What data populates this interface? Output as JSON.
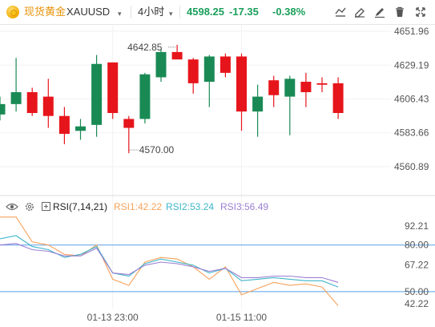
{
  "header": {
    "symbol_name": "现货黄金",
    "symbol_code": "XAUUSD",
    "symbol_chevron": "▾",
    "interval": "4小时",
    "interval_chevron": "▾",
    "last_price": "4598.25",
    "change_abs": "-17.35",
    "change_pct": "-0.38%",
    "icons": [
      "gold-coin-icon",
      "line-chart-icon",
      "eraser-icon",
      "pencil-icon",
      "trash-icon",
      "fullscreen-icon"
    ]
  },
  "rsi_legend": {
    "eye_icon": "eye-icon",
    "gear_icon": "gear-icon",
    "expand_icon": "plus-square-icon",
    "title": "RSI(7,14,21)",
    "rsi1": "RSI1:42.22",
    "rsi2": "RSI2:53.24",
    "rsi3": "RSI3:56.49"
  },
  "colors": {
    "up": "#1a8a55",
    "down": "#e6151b",
    "rsi1": "#f7a35c",
    "rsi2": "#3fb6c9",
    "rsi3": "#9b7fd4",
    "level_line": "#5aa0e6",
    "price_accent": "#1a9f5b",
    "symbol_accent": "#e8930a"
  },
  "chart_data": [
    {
      "type": "candlestick",
      "price_ticks": [
        "4651.96",
        "4629.19",
        "4606.43",
        "4583.66",
        "4560.89"
      ],
      "ylim": [
        4557,
        4655
      ],
      "annotations": {
        "high_label": "4642.85",
        "low_label": "4570.00"
      },
      "candles": [
        {
          "o": 4596.0,
          "h": 4608.0,
          "l": 4592.0,
          "c": 4603.0
        },
        {
          "o": 4603.0,
          "h": 4634.0,
          "l": 4598.0,
          "c": 4611.0
        },
        {
          "o": 4611.0,
          "h": 4614.0,
          "l": 4595.0,
          "c": 4597.0
        },
        {
          "o": 4608.0,
          "h": 4620.0,
          "l": 4587.0,
          "c": 4595.0
        },
        {
          "o": 4595.0,
          "h": 4601.0,
          "l": 4576.0,
          "c": 4583.0
        },
        {
          "o": 4585.0,
          "h": 4593.0,
          "l": 4579.0,
          "c": 4588.0
        },
        {
          "o": 4589.0,
          "h": 4636.0,
          "l": 4581.0,
          "c": 4630.0
        },
        {
          "o": 4631.0,
          "h": 4631.0,
          "l": 4593.0,
          "c": 4597.0
        },
        {
          "o": 4593.0,
          "h": 4595.0,
          "l": 4570.0,
          "c": 4587.0
        },
        {
          "o": 4593.0,
          "h": 4624.0,
          "l": 4590.0,
          "c": 4623.0
        },
        {
          "o": 4621.0,
          "h": 4640.0,
          "l": 4618.0,
          "c": 4638.0
        },
        {
          "o": 4638.0,
          "h": 4642.85,
          "l": 4636.0,
          "c": 4633.0
        },
        {
          "o": 4633.0,
          "h": 4634.0,
          "l": 4610.0,
          "c": 4617.0
        },
        {
          "o": 4618.0,
          "h": 4636.0,
          "l": 4601.0,
          "c": 4635.0
        },
        {
          "o": 4635.0,
          "h": 4637.0,
          "l": 4621.0,
          "c": 4624.0
        },
        {
          "o": 4635.0,
          "h": 4637.0,
          "l": 4585.0,
          "c": 4598.0
        },
        {
          "o": 4598.0,
          "h": 4616.0,
          "l": 4581.0,
          "c": 4608.0
        },
        {
          "o": 4619.0,
          "h": 4622.0,
          "l": 4601.0,
          "c": 4609.0
        },
        {
          "o": 4608.0,
          "h": 4622.0,
          "l": 4582.0,
          "c": 4620.0
        },
        {
          "o": 4618.0,
          "h": 4624.0,
          "l": 4601.0,
          "c": 4611.0
        },
        {
          "o": 4617.0,
          "h": 4621.0,
          "l": 4611.0,
          "c": 4616.0
        },
        {
          "o": 4617.0,
          "h": 4621.0,
          "l": 4593.0,
          "c": 4597.0
        }
      ]
    },
    {
      "type": "line",
      "title": "RSI(7,14,21)",
      "value_ticks": [
        "92.21",
        "80.00",
        "67.22",
        "50.00",
        "42.22"
      ],
      "ylim": [
        38,
        101
      ],
      "levels": [
        80,
        50
      ],
      "series": [
        {
          "name": "RSI1",
          "values": [
            98,
            98,
            82,
            80,
            74,
            73,
            80,
            58,
            54,
            69,
            72,
            71,
            66,
            58,
            66,
            48,
            52,
            56,
            54,
            55,
            53,
            41
          ]
        },
        {
          "name": "RSI2",
          "values": [
            84,
            86,
            79,
            77,
            72,
            74,
            79,
            62,
            60,
            68,
            71,
            69,
            67,
            62,
            65,
            57,
            58,
            59,
            58,
            57,
            57,
            53
          ]
        },
        {
          "name": "RSI3",
          "values": [
            80,
            81,
            77,
            76,
            73,
            73,
            78,
            62,
            61,
            67,
            69,
            68,
            66,
            63,
            65,
            59,
            59,
            60,
            60,
            59,
            59,
            56
          ]
        }
      ],
      "x_ticks": [
        "01-13 23:00",
        "01-15 11:00"
      ]
    }
  ]
}
